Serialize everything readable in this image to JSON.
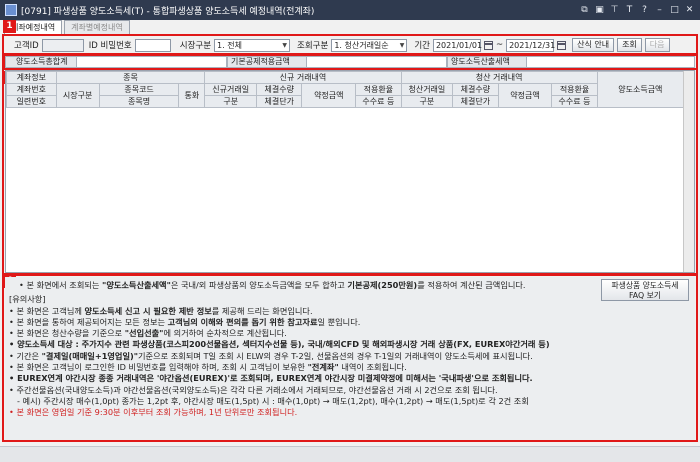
{
  "window": {
    "title": "[0791] 파생상품 양도소득세(T) - 통합파생상품 양도소득세 예정내역(전계좌)"
  },
  "tabs": [
    "계좌예정내역",
    "계좌별예정내역"
  ],
  "regions": [
    "1",
    "2",
    "3",
    "4"
  ],
  "query": {
    "account_id_label": "고객ID",
    "account_id_value": "",
    "id_password_label": "ID 비밀번호",
    "id_password_value": "",
    "market_label": "시장구분",
    "market_value": "1. 전체",
    "order_label": "조회구분",
    "order_value": "1. 청산거래일순",
    "period_label": "기간",
    "date_from": "2021/01/01",
    "date_to": "2021/12/31",
    "tilde": "~",
    "calc_guide_button": "산식 안내",
    "search_button": "조회",
    "next_button": "다음"
  },
  "summary": {
    "total_tax_label": "양도소득총합계",
    "basic_deduction_label": "기본공제적용금액",
    "tax_calculated_label": "양도소득산출세액"
  },
  "grid": {
    "h_account_info": "계좌정보",
    "h_item": "종목",
    "h_new_trade": "신규 거래내역",
    "h_close_trade": "청산 거래내역",
    "h_tax_amount": "양도소득금액",
    "h_account_no": "계좌번호",
    "h_serial": "일련번호",
    "h_market": "시장구분",
    "h_item_code": "종목코드",
    "h_item_name": "종목명",
    "h_currency": "통화",
    "h_new_date": "신규거래일",
    "h_type": "구분",
    "h_qty": "체결수량",
    "h_price": "체결단가",
    "h_contract_amt": "약정금액",
    "h_rate": "적용환율",
    "h_fee": "수수료 등",
    "h_close_date": "청산거래일"
  },
  "notes": {
    "faq_button_line1": "파생상품 양도소득세",
    "faq_button_line2": "FAQ 보기",
    "intro_pre": "본 화면에서 조회되는 ",
    "intro_b1": "\"양도소득산출세액\"",
    "intro_mid": "은 국내/외 파생상품의 양도소득금액을 모두 합하고 ",
    "intro_b2": "기본공제(250만원)",
    "intro_post": "를 적용하여 계산된 금액입니다.",
    "caution_title": "[유의사항]",
    "n1_pre": "본 화면은 고객님께 ",
    "n1_b": "양도소득세 신고 시 필요한 제반 정보",
    "n1_post": "를 제공해 드리는 화면입니다.",
    "n2_pre": "본 화면을 통하여 제공되어지는 모든 정보는 ",
    "n2_b": "고객님의 이해와 편의를 돕기 위한 참고자료",
    "n2_post": "일 뿐입니다.",
    "n3_pre": "본 화면은 청산수량을 기준으로 ",
    "n3_b": "\"선입선출\"",
    "n3_post": "에 의거하여 순차적으로 계산됩니다.",
    "n4": "양도소득세 대상 : 주가지수 관련 파생상품(코스피200선물옵션, 섹터지수선물 등), 국내/해외CFD 및 해외파생시장 거래 상품(FX, EUREX야간거래 등)",
    "n5_pre": "기간은 ",
    "n5_b": "\"결제일(매매일+1영업일)\"",
    "n5_post": "기준으로 조회되며 T일 조회 시 ELW의 경우 T-2일, 선물옵션의 경우 T-1일의 거래내역이 양도소득세에 표시됩니다.",
    "n6_pre": "본 화면은 고객님이 로그인한 ID 비밀번호를 입력해야 하며, 조회 시 고객님이 보유한 ",
    "n6_b": "\"전계좌\"",
    "n6_post": " 내역이 조회됩니다.",
    "n7": "EUREX연계 야간시장 종종 거래내역은 '야간옵션(EUREX)'로 조회되며, EUREX연계 야간시장 미결제약정에 미해서는 '국내파생'으로 조회됩니다.",
    "n8": "주간선물옵션(국내양도소득)과 야간선물옵션(국외양도소득)은 각각 다른 거래소에서 거래되므로, 야간선물옵션 거래 시 2건으로 조회 됩니다.",
    "n9": "- 예시) 주간시장 매수(1,0pt) 종가는 1,2pt 후, 야간시장 매도(1,5pt) 시 : 매수(1,0pt) → 매도(1,2pt), 매수(1,2pt) → 매도(1,5pt)로 각 2건 조회",
    "n10": "본 화면은 영업일 기준 9:30분 이후부터 조회 가능하며, 1년 단위로만 조회됩니다."
  },
  "colors": {
    "highlight_red": "#e01818",
    "titlebar": "#2f3a4f",
    "note_red": "#d02020"
  }
}
